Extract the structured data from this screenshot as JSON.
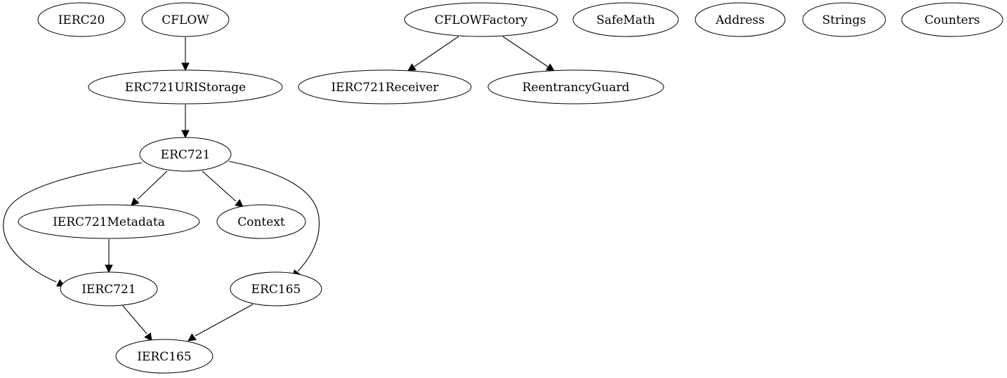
{
  "diagram": {
    "type": "directed-graph",
    "nodes": [
      {
        "id": "IERC20",
        "label": "IERC20"
      },
      {
        "id": "CFLOW",
        "label": "CFLOW"
      },
      {
        "id": "ERC721URIStorage",
        "label": "ERC721URIStorage"
      },
      {
        "id": "ERC721",
        "label": "ERC721"
      },
      {
        "id": "IERC721Metadata",
        "label": "IERC721Metadata"
      },
      {
        "id": "Context",
        "label": "Context"
      },
      {
        "id": "IERC721",
        "label": "IERC721"
      },
      {
        "id": "ERC165",
        "label": "ERC165"
      },
      {
        "id": "IERC165",
        "label": "IERC165"
      },
      {
        "id": "CFLOWFactory",
        "label": "CFLOWFactory"
      },
      {
        "id": "IERC721Receiver",
        "label": "IERC721Receiver"
      },
      {
        "id": "ReentrancyGuard",
        "label": "ReentrancyGuard"
      },
      {
        "id": "SafeMath",
        "label": "SafeMath"
      },
      {
        "id": "Address",
        "label": "Address"
      },
      {
        "id": "Strings",
        "label": "Strings"
      },
      {
        "id": "Counters",
        "label": "Counters"
      }
    ],
    "edges": [
      {
        "from": "CFLOW",
        "to": "ERC721URIStorage"
      },
      {
        "from": "ERC721URIStorage",
        "to": "ERC721"
      },
      {
        "from": "ERC721",
        "to": "IERC721"
      },
      {
        "from": "ERC721",
        "to": "IERC721Metadata"
      },
      {
        "from": "ERC721",
        "to": "Context"
      },
      {
        "from": "ERC721",
        "to": "ERC165"
      },
      {
        "from": "IERC721Metadata",
        "to": "IERC721"
      },
      {
        "from": "IERC721",
        "to": "IERC165"
      },
      {
        "from": "ERC165",
        "to": "IERC165"
      },
      {
        "from": "CFLOWFactory",
        "to": "IERC721Receiver"
      },
      {
        "from": "CFLOWFactory",
        "to": "ReentrancyGuard"
      }
    ]
  }
}
